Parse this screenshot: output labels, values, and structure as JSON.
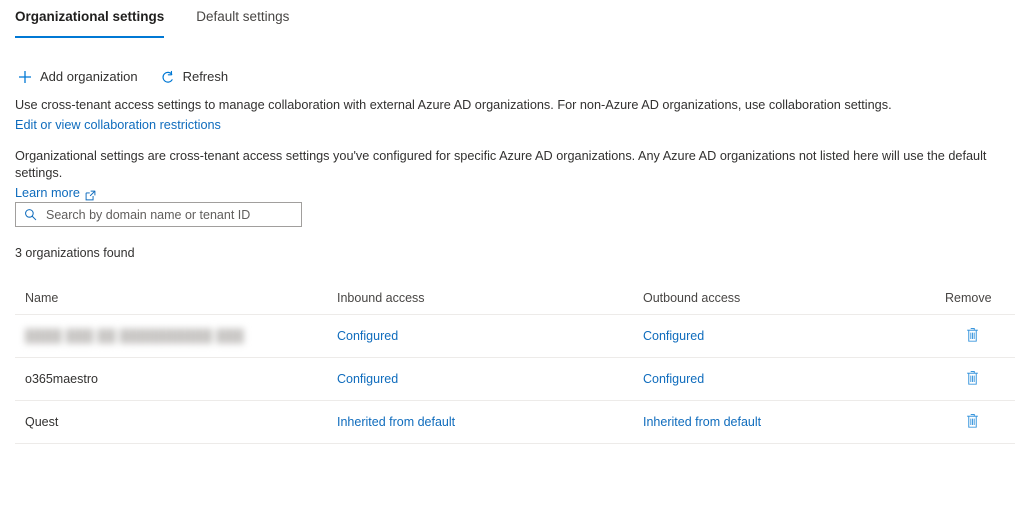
{
  "tabs": [
    {
      "label": "Organizational settings",
      "active": true,
      "name": "tab-organizational-settings"
    },
    {
      "label": "Default settings",
      "active": false,
      "name": "tab-default-settings"
    }
  ],
  "commandbar": {
    "add_organization": {
      "label": "Add organization",
      "icon": "plus-icon"
    },
    "refresh": {
      "label": "Refresh",
      "icon": "refresh-icon"
    }
  },
  "description": {
    "paragraph_1": "Use cross-tenant access settings to manage collaboration with external Azure AD organizations. For non-Azure AD organizations, use collaboration settings.",
    "link_1": "Edit or view collaboration restrictions",
    "paragraph_2": "Organizational settings are cross-tenant access settings you've configured for specific Azure AD organizations. Any Azure AD organizations not listed here will use the default settings.",
    "link_2": "Learn more",
    "link_2_icon": "external-link-icon"
  },
  "search": {
    "placeholder": "Search by domain name or tenant ID",
    "value": "",
    "icon": "search-icon"
  },
  "results_summary": "3 organizations found",
  "table": {
    "columns": [
      "Name",
      "Inbound access",
      "Outbound access",
      "Remove"
    ],
    "rows": [
      {
        "name": "████ ███ ██  ██████████  ███",
        "name_redacted": true,
        "inbound": "Configured",
        "outbound": "Configured",
        "remove_icon": "trash-icon"
      },
      {
        "name": "o365maestro",
        "name_redacted": false,
        "inbound": "Configured",
        "outbound": "Configured",
        "remove_icon": "trash-icon"
      },
      {
        "name": "Quest",
        "name_redacted": false,
        "inbound": "Inherited from default",
        "outbound": "Inherited from default",
        "remove_icon": "trash-icon"
      }
    ]
  },
  "colors": {
    "accent": "#0078d4",
    "link": "#0f6cbd",
    "icon_blue": "#3a96dd",
    "text": "#323130",
    "border": "#edebe9",
    "input_border": "#a19f9d",
    "background": "#ffffff"
  }
}
